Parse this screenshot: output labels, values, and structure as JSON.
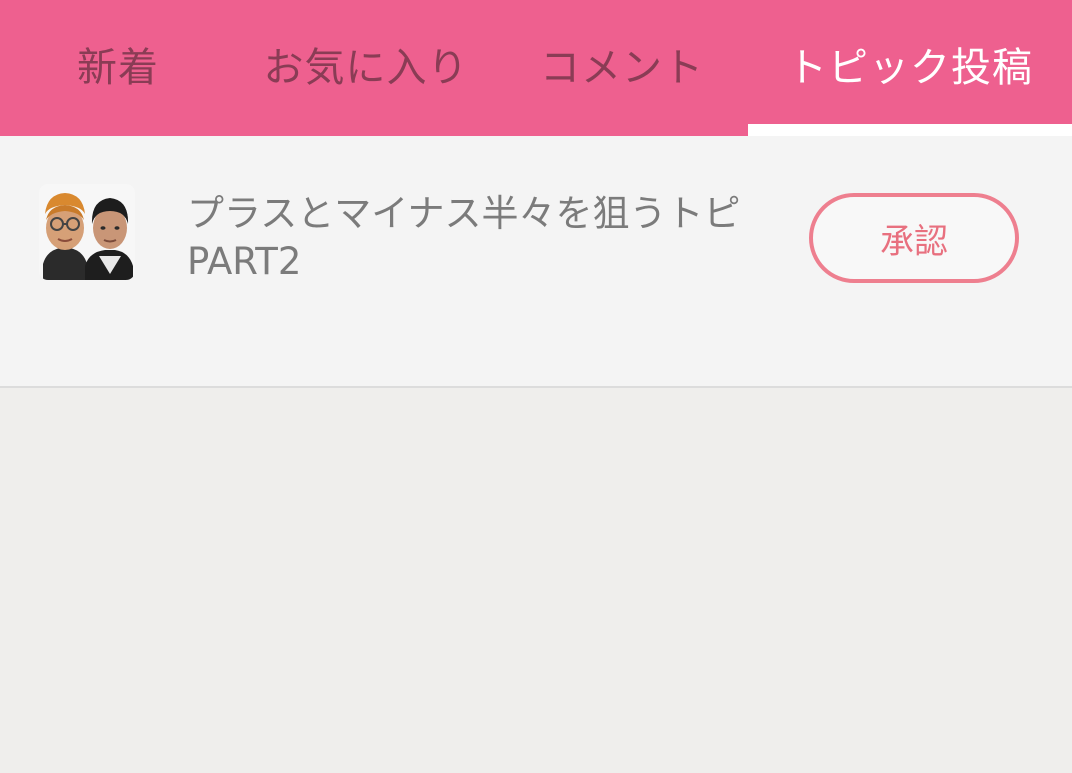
{
  "tabs": [
    {
      "label": "新着"
    },
    {
      "label": "お気に入り"
    },
    {
      "label": "コメント"
    },
    {
      "label": "トピック投稿",
      "active": true
    }
  ],
  "colors": {
    "tab_bar": "#ee608f",
    "tab_inactive_text": "#8a3c55",
    "tab_active_text": "#ffffff",
    "accent_button": "#ee7f8f"
  },
  "topics": [
    {
      "title": "プラスとマイナス半々を狙うトピ　PART2",
      "thumbnail_icon": "topic-thumbnail-photo",
      "action_label": "承認"
    }
  ]
}
